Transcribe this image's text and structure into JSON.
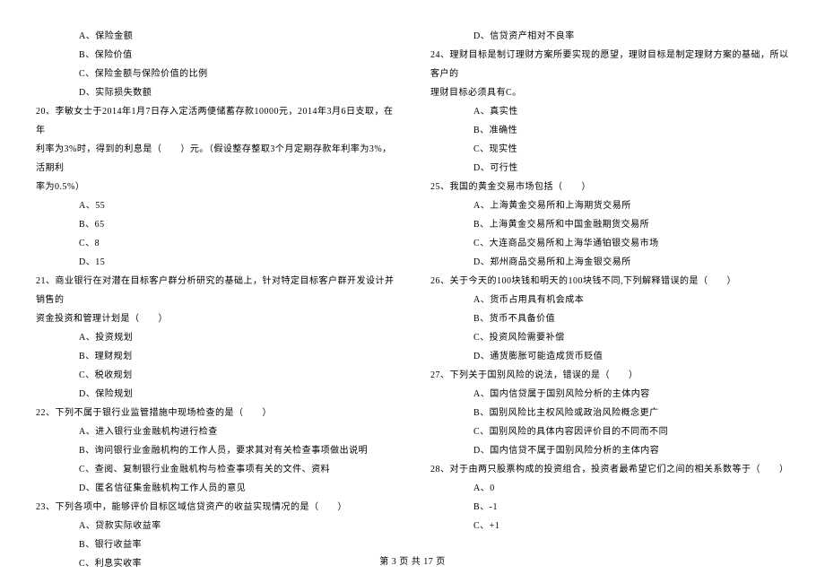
{
  "left": {
    "q19_opts": [
      "A、保险金额",
      "B、保险价值",
      "C、保险金额与保险价值的比例",
      "D、实际损失数额"
    ],
    "q20_line1": "20、李敏女士于2014年1月7日存入定活两便储蓄存款10000元，2014年3月6日支取，在年",
    "q20_line2": "利率为3%时，得到的利息是（　　）元。（假设整存整取3个月定期存款年利率为3%，活期利",
    "q20_line3": "率为0.5%）",
    "q20_opts": [
      "A、55",
      "B、65",
      "C、8",
      "D、15"
    ],
    "q21_line1": "21、商业银行在对潜在目标客户群分析研究的基础上，针对特定目标客户群开发设计并销售的",
    "q21_line2": "资金投资和管理计划是（　　）",
    "q21_opts": [
      "A、投资规划",
      "B、理财规划",
      "C、税收规划",
      "D、保险规划"
    ],
    "q22_stem": "22、下列不属于银行业监管措施中现场检查的是（　　）",
    "q22_opts": [
      "A、进入银行业金融机构进行检查",
      "B、询问银行业金融机构的工作人员，要求其对有关检查事项做出说明",
      "C、查阅、复制银行业金融机构与检查事项有关的文件、资料",
      "D、匿名信征集金融机构工作人员的意见"
    ],
    "q23_stem": "23、下列各项中，能够评价目标区域信贷资产的收益实现情况的是（　　）",
    "q23_opts": [
      "A、贷款实际收益率",
      "B、银行收益率",
      "C、利息实收率"
    ]
  },
  "right": {
    "q23d": "D、信贷资产相对不良率",
    "q24_line1": "24、理财目标是制订理财方案所要实现的愿望，理财目标是制定理财方案的基础，所以客户的",
    "q24_line2": "理财目标必须具有C。",
    "q24_opts": [
      "A、真实性",
      "B、准确性",
      "C、现实性",
      "D、可行性"
    ],
    "q25_stem": "25、我国的黄金交易市场包括（　　）",
    "q25_opts": [
      "A、上海黄金交易所和上海期货交易所",
      "B、上海黄金交易所和中国金融期货交易所",
      "C、大连商品交易所和上海华通铂银交易市场",
      "D、郑州商品交易所和上海金银交易所"
    ],
    "q26_stem": "26、关于今天的100块钱和明天的100块钱不同,下列解释错误的是（　　）",
    "q26_opts": [
      "A、货币占用具有机会成本",
      "B、货币不具备价值",
      "C、投资风险需要补偿",
      "D、通货膨胀可能造成货币贬值"
    ],
    "q27_stem": "27、下列关于国别风险的说法，错误的是（　　）",
    "q27_opts": [
      "A、国内信贷属于国别风险分析的主体内容",
      "B、国别风险比主权风险或政治风险概念更广",
      "C、国别风险的具体内容因评价目的不同而不同",
      "D、国内信贷不属于国别风险分析的主体内容"
    ],
    "q28_stem": "28、对于由两只股票构成的投资组合，投资者最希望它们之间的相关系数等于（　　）",
    "q28_opts": [
      "A、0",
      "B、-1",
      "C、+1"
    ]
  },
  "footer": "第 3 页 共 17 页"
}
